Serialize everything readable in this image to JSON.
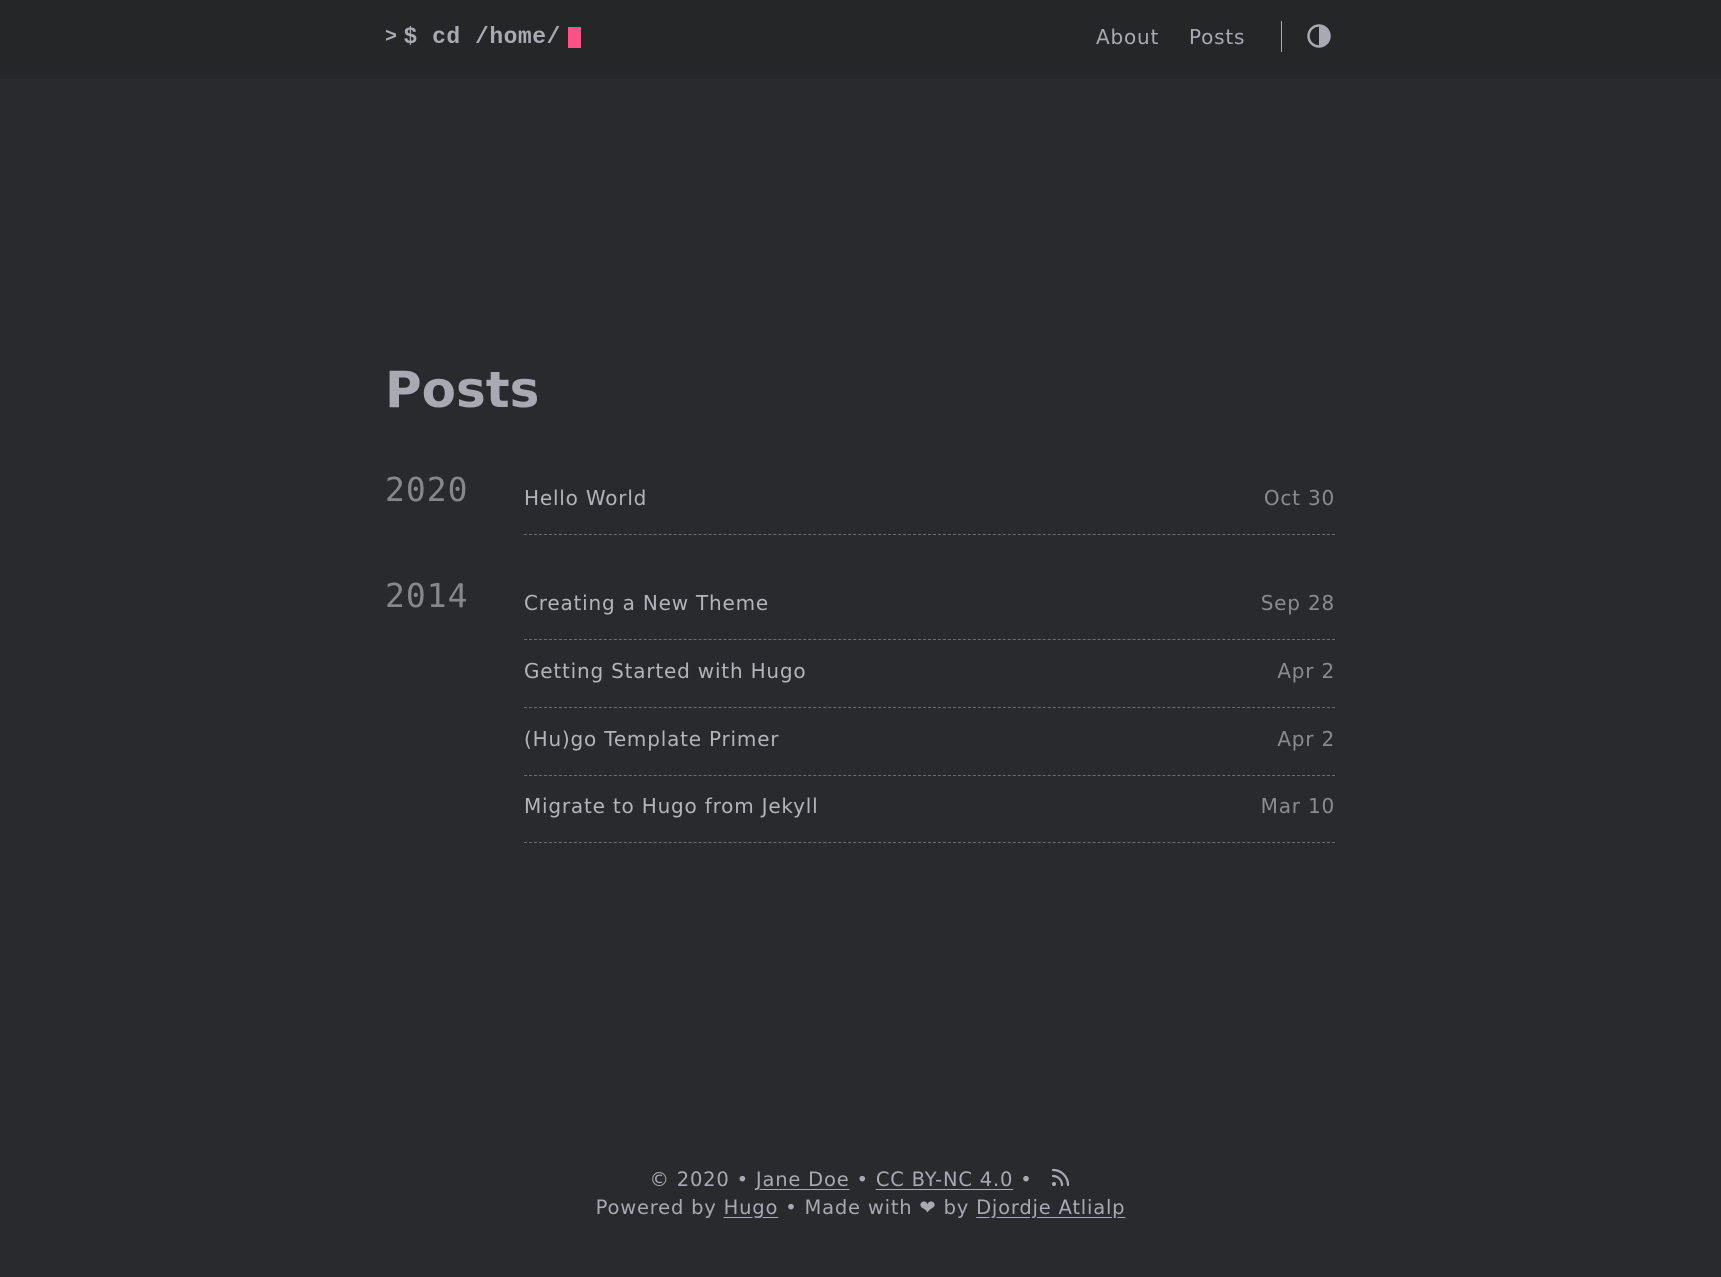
{
  "header": {
    "logo_prefix": ">",
    "logo_text": "$ cd /home/",
    "cursor_color": "#fe5186",
    "nav": {
      "about": "About",
      "posts": "Posts"
    },
    "theme_toggle_icon": "contrast-icon"
  },
  "main": {
    "title": "Posts",
    "groups": [
      {
        "year": "2020",
        "posts": [
          {
            "title": "Hello World",
            "date": "Oct 30"
          }
        ]
      },
      {
        "year": "2014",
        "posts": [
          {
            "title": "Creating a New Theme",
            "date": "Sep 28"
          },
          {
            "title": "Getting Started with Hugo",
            "date": "Apr 2"
          },
          {
            "title": "(Hu)go Template Primer",
            "date": "Apr 2"
          },
          {
            "title": "Migrate to Hugo from Jekyll",
            "date": "Mar 10"
          }
        ]
      }
    ]
  },
  "footer": {
    "copyright": "© 2020",
    "sep": "•",
    "author": "Jane Doe",
    "license": "CC BY-NC 4.0",
    "rss_icon": "rss-icon",
    "powered_by": "Powered by",
    "hugo": "Hugo",
    "made_with": "Made with",
    "heart": "❤",
    "by": "by",
    "theme_author": "Djordje Atlialp"
  }
}
